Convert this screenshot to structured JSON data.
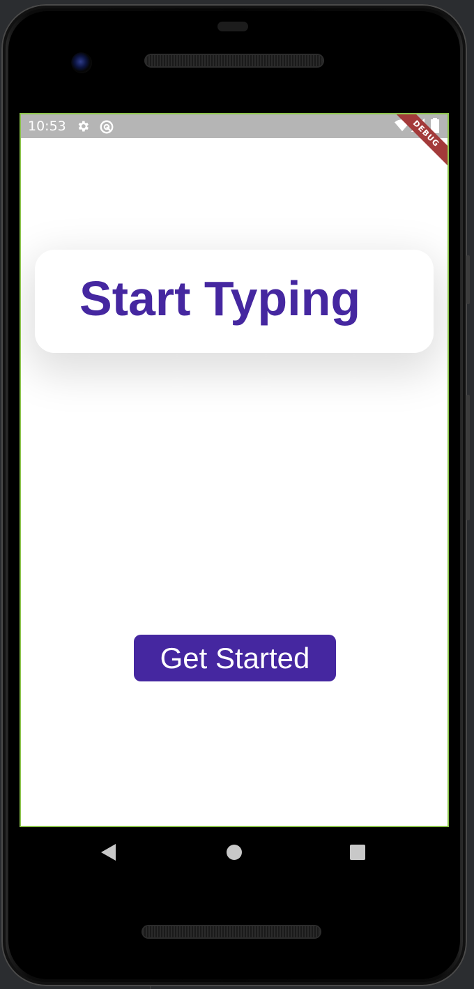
{
  "status_bar": {
    "time": "10:53",
    "icons": [
      "settings-icon",
      "app-notification-icon",
      "wifi-icon",
      "cellular-signal-icon",
      "battery-icon"
    ],
    "background": "#b5b5b5"
  },
  "debug_banner": {
    "label": "DEBUG",
    "color": "#a33a3a"
  },
  "app": {
    "title": "Start Typing",
    "primary_color": "#4527a0",
    "get_started_label": "Get Started"
  },
  "nav_bar": {
    "icons": [
      "back-icon",
      "home-icon",
      "recents-icon"
    ]
  }
}
